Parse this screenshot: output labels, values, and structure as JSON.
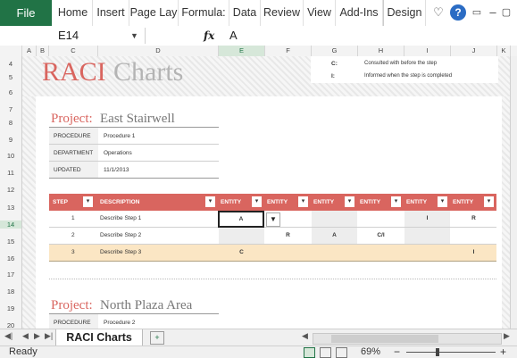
{
  "ribbon": {
    "file": "File",
    "tabs": [
      "Home",
      "Insert",
      "Page Lay",
      "Formula:",
      "Data",
      "Review",
      "View",
      "Add-Ins",
      "Design"
    ],
    "help": "?"
  },
  "formula_bar": {
    "name_box": "E14",
    "fx": "fx",
    "value": "A"
  },
  "columns": [
    "A",
    "B",
    "C",
    "D",
    "E",
    "F",
    "G",
    "H",
    "I",
    "J",
    "K"
  ],
  "rows": [
    "4",
    "5",
    "6",
    "7",
    "8",
    "9",
    "10",
    "11",
    "12",
    "13",
    "14",
    "15",
    "16",
    "17",
    "18",
    "19",
    "20"
  ],
  "title": {
    "raci": "RACI",
    "charts": "Charts"
  },
  "legend": [
    {
      "key": "C:",
      "text": "Consulted with before the step"
    },
    {
      "key": "I:",
      "text": "Informed when the step is completed"
    }
  ],
  "project1": {
    "label": "Project:",
    "name": "East Stairwell",
    "meta": [
      {
        "key": "PROCEDURE",
        "value": "Procedure 1"
      },
      {
        "key": "DEPARTMENT",
        "value": "Operations"
      },
      {
        "key": "UPDATED",
        "value": "11/1/2013"
      }
    ]
  },
  "table": {
    "headers": [
      "STEP",
      "DESCRIPTION",
      "ENTITY",
      "ENTITY",
      "ENTITY",
      "ENTITY",
      "ENTITY",
      "ENTITY"
    ],
    "rows": [
      {
        "step": "1",
        "desc": "Describe Step 1",
        "cells": [
          "A",
          "",
          "",
          "",
          "I",
          "R"
        ]
      },
      {
        "step": "2",
        "desc": "Describe Step 2",
        "cells": [
          "",
          "R",
          "A",
          "C/I",
          "",
          ""
        ]
      },
      {
        "step": "3",
        "desc": "Describe Step 3",
        "cells": [
          "C",
          "",
          "",
          "",
          "",
          "I"
        ]
      }
    ]
  },
  "project2": {
    "label": "Project:",
    "name": "North Plaza Area",
    "meta": [
      {
        "key": "PROCEDURE",
        "value": "Procedure 2"
      }
    ]
  },
  "sheet_tab": "RACI Charts",
  "status": {
    "ready": "Ready",
    "zoom": "69%"
  },
  "colors": {
    "accent": "#d9655f",
    "excel_green": "#217346",
    "highlight_row": "#fbe6c4"
  }
}
